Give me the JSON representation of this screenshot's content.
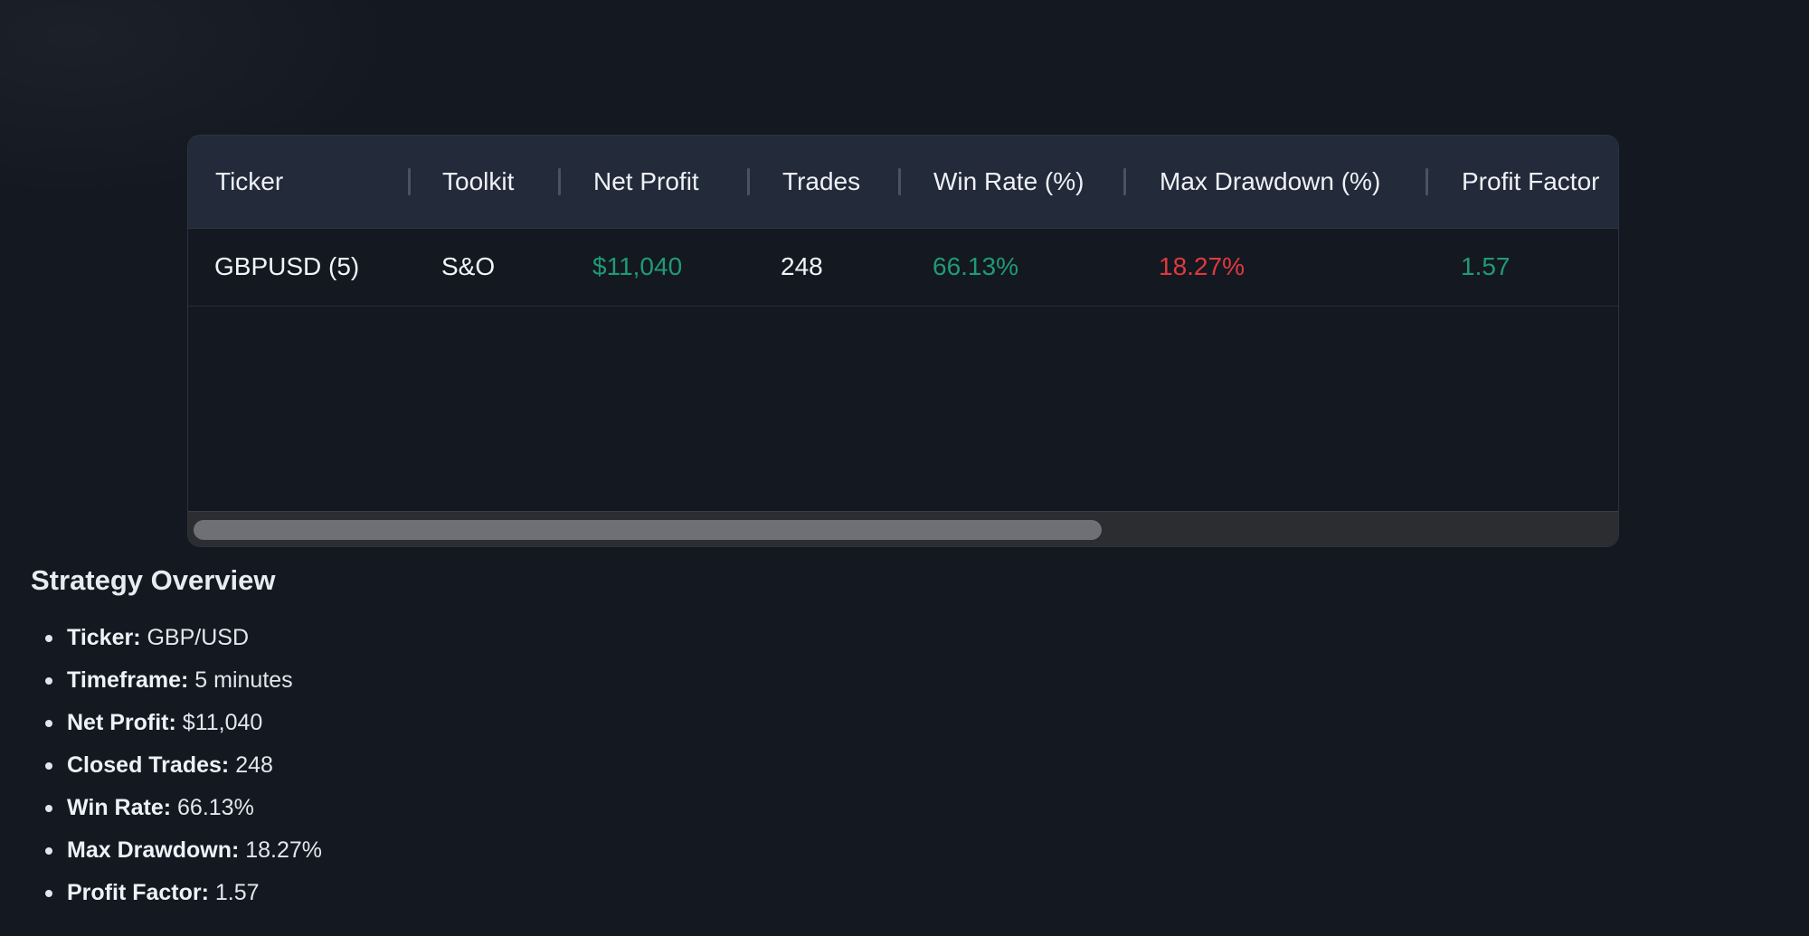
{
  "table": {
    "columns": [
      "Ticker",
      "Toolkit",
      "Net Profit",
      "Trades",
      "Win Rate (%)",
      "Max Drawdown (%)",
      "Profit Factor"
    ],
    "rows": [
      {
        "ticker": "GBPUSD (5)",
        "toolkit": "S&O",
        "net_profit": "$11,040",
        "trades": "248",
        "win_rate": "66.13%",
        "max_drawdown": "18.27%",
        "profit_factor": "1.57"
      }
    ],
    "scroll_position_fraction": 0.64
  },
  "colors": {
    "positive": "#1f9a76",
    "negative": "#e0393e",
    "background": "#141821",
    "header_bg": "#232a39"
  },
  "overview": {
    "title": "Strategy Overview",
    "items": [
      {
        "label": "Ticker:",
        "value": "GBP/USD"
      },
      {
        "label": "Timeframe:",
        "value": "5 minutes"
      },
      {
        "label": "Net Profit:",
        "value": "$11,040"
      },
      {
        "label": "Closed Trades:",
        "value": "248"
      },
      {
        "label": "Win Rate:",
        "value": "66.13%"
      },
      {
        "label": "Max Drawdown:",
        "value": "18.27%"
      },
      {
        "label": "Profit Factor:",
        "value": "1.57"
      }
    ]
  }
}
